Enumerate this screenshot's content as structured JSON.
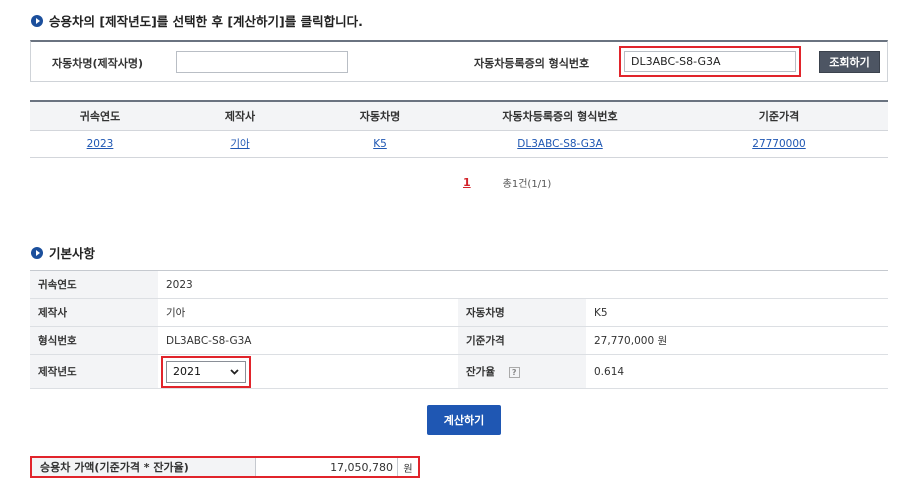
{
  "step1": {
    "heading": "승용차의 [제작년도]를 선택한 후 [계산하기]를 클릭합니다."
  },
  "search": {
    "vehicle_name_label": "자동차명(제작사명)",
    "vehicle_name_value": "",
    "type_no_label": "자동차등록증의 형식번호",
    "type_no_value": "DL3ABC-S8-G3A",
    "search_button": "조회하기"
  },
  "results": {
    "columns": [
      "귀속연도",
      "제작사",
      "자동차명",
      "자동차등록증의 형식번호",
      "기준가격"
    ],
    "rows": [
      [
        "2023",
        "기아",
        "K5",
        "DL3ABC-S8-G3A",
        "27770000"
      ]
    ],
    "current_page": "1",
    "total_text": "총1건(1/1)"
  },
  "basic": {
    "heading": "기본사항",
    "year_label": "귀속연도",
    "year_value": "2023",
    "maker_label": "제작사",
    "maker_value": "기아",
    "car_name_label": "자동차명",
    "car_name_value": "K5",
    "type_label": "형식번호",
    "type_value": "DL3ABC-S8-G3A",
    "base_price_label": "기준가격",
    "base_price_value": "27,770,000 원",
    "mfg_year_label": "제작년도",
    "mfg_year_selected": "2021",
    "residual_label": "잔가율",
    "residual_help": "?",
    "residual_value": "0.614"
  },
  "calc_button": "계산하기",
  "price": {
    "label": "승용차 가액(기준가격 * 잔가율)",
    "value": "17,050,780",
    "unit": "원"
  },
  "colors": {
    "accent": "#1f57b3",
    "highlight": "#e1242b",
    "dark_button": "#4d5563"
  },
  "icons": [
    "bullet-arrow-icon",
    "chevron-down-icon",
    "help-icon"
  ]
}
